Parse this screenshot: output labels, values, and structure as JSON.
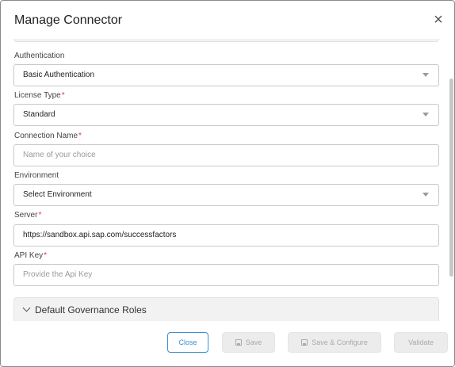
{
  "dialog": {
    "title": "Manage Connector",
    "close_glyph": "×"
  },
  "fields": {
    "authentication": {
      "label": "Authentication",
      "value": "Basic Authentication"
    },
    "license_type": {
      "label": "License Type",
      "required_mark": "*",
      "value": "Standard"
    },
    "connection_name": {
      "label": "Connection Name",
      "required_mark": "*",
      "placeholder": "Name of your choice"
    },
    "environment": {
      "label": "Environment",
      "value": "Select Environment"
    },
    "server": {
      "label": "Server",
      "required_mark": "*",
      "value": "https://sandbox.api.sap.com/successfactors"
    },
    "api_key": {
      "label": "API Key",
      "required_mark": "*",
      "placeholder": "Provide the Api Key"
    }
  },
  "accordion": {
    "label": "Default Governance Roles",
    "expanded": false
  },
  "footer": {
    "close_label": "Close",
    "save_label": "Save",
    "save_configure_label": "Save & Configure",
    "validate_label": "Validate"
  },
  "icons": {
    "close": "close-icon",
    "dropdown": "caret-down-icon",
    "accordion": "chevron-down-icon",
    "save": "save-icon"
  },
  "colors": {
    "accent": "#3c8fd6",
    "required": "#e53935",
    "disabled_bg": "#ececec",
    "disabled_text": "#a9a9a9"
  }
}
